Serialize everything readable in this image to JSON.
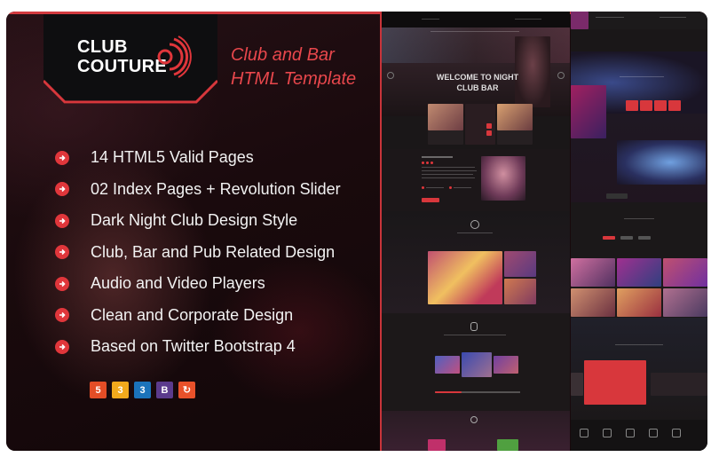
{
  "brand": {
    "line1": "CLUB",
    "line2": "COUTURE",
    "accent_color": "#e0363b"
  },
  "tagline": {
    "line1": "Club and Bar",
    "line2": "HTML Template"
  },
  "features": [
    "14 HTML5 Valid Pages",
    "02 Index Pages + Revolution Slider",
    "Dark Night Club Design Style",
    "Club, Bar and Pub Related Design",
    "Audio and Video Players",
    "Clean and Corporate Design",
    "Based on Twitter Bootstrap 4"
  ],
  "tech_icons": [
    {
      "name": "html5-icon",
      "glyph": "5",
      "color": "#e44d26"
    },
    {
      "name": "css3-icon",
      "glyph": "3",
      "color": "#f2a91c"
    },
    {
      "name": "css3-alt-icon",
      "glyph": "3",
      "color": "#1b73ba"
    },
    {
      "name": "bootstrap-icon",
      "glyph": "B",
      "color": "#5b3b8c"
    },
    {
      "name": "refresh-icon",
      "glyph": "↻",
      "color": "#e8512a"
    }
  ],
  "preview": {
    "hero_title_1": "WELCOME TO NIGHT",
    "hero_title_2": "CLUB BAR"
  }
}
